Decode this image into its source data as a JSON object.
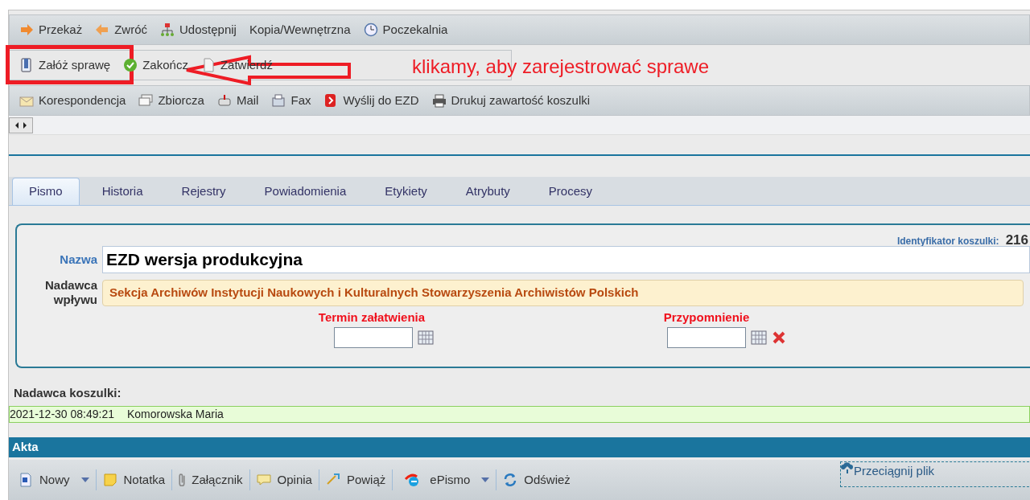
{
  "toolbar_1": [
    {
      "label": "Przekaż"
    },
    {
      "label": "Zwróć"
    },
    {
      "label": "Udostępnij"
    },
    {
      "label": "Kopia/Wewnętrzna"
    },
    {
      "label": "Poczekalnia"
    }
  ],
  "toolbar_2": [
    {
      "label": "Załóż sprawę"
    },
    {
      "label": "Zakończ"
    },
    {
      "label": "Zatwierdź"
    }
  ],
  "toolbar_3": [
    {
      "label": "Korespondencja"
    },
    {
      "label": "Zbiorcza"
    },
    {
      "label": "Mail"
    },
    {
      "label": "Fax"
    },
    {
      "label": "Wyślij do EZD"
    },
    {
      "label": "Drukuj zawartość koszulki"
    }
  ],
  "annotation": {
    "text": "klikamy, aby zarejestrować sprawe"
  },
  "tabs": [
    {
      "label": "Pismo",
      "selected": true
    },
    {
      "label": "Historia",
      "selected": false
    },
    {
      "label": "Rejestry",
      "selected": false
    },
    {
      "label": "Powiadomienia",
      "selected": false
    },
    {
      "label": "Etykiety",
      "selected": false
    },
    {
      "label": "Atrybuty",
      "selected": false
    },
    {
      "label": "Procesy",
      "selected": false
    }
  ],
  "form": {
    "identifier_label": "Identyfikator koszulki:",
    "identifier_value": "216",
    "name_label": "Nazwa",
    "name_value": "EZD wersja produkcyjna",
    "sender_label": "Nadawca wpływu",
    "sender_value": "Sekcja Archiwów Instytucji Naukowych i Kulturalnych Stowarzyszenia Archiwistów Polskich",
    "due_label": "Termin załatwienia",
    "reminder_label": "Przypomnienie"
  },
  "folder_sender": {
    "label": "Nadawca koszulki:",
    "date": "2021-12-30 08:49:21",
    "person": "Komorowska Maria"
  },
  "files_section": {
    "title": "Akta",
    "toolbar": [
      {
        "label": "Nowy",
        "dropdown": true
      },
      {
        "label": "Notatka",
        "dropdown": false
      },
      {
        "label": "Załącznik",
        "dropdown": false
      },
      {
        "label": "Opinia",
        "dropdown": false
      },
      {
        "label": "Powiąż",
        "dropdown": false
      },
      {
        "label": "ePismo",
        "dropdown": true
      },
      {
        "label": "Odśwież",
        "dropdown": false
      }
    ],
    "drop_zone": "Przeciągnij plik"
  }
}
